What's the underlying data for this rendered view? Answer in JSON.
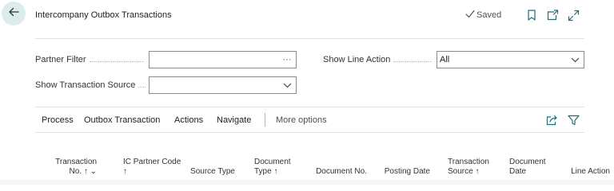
{
  "header": {
    "title": "Intercompany Outbox Transactions",
    "saved_label": "Saved"
  },
  "filters": {
    "partner_filter": {
      "label": "Partner Filter",
      "value": "",
      "lookup_glyph": "···"
    },
    "show_transaction_source": {
      "label": "Show Transaction Source",
      "value": ""
    },
    "show_line_action": {
      "label": "Show Line Action",
      "value": "All"
    }
  },
  "action_bar": {
    "items": [
      "Process",
      "Outbox Transaction",
      "Actions",
      "Navigate"
    ],
    "more": "More options"
  },
  "table": {
    "columns": [
      {
        "line1": "Transaction",
        "line2": "No.",
        "sort": "↑",
        "extra": "⌄"
      },
      {
        "line1": "IC Partner Code",
        "line2": "",
        "sort": "↑",
        "extra": ""
      },
      {
        "line1": "",
        "line2": "Source Type",
        "sort": "",
        "extra": ""
      },
      {
        "line1": "Document",
        "line2": "Type",
        "sort": "↑",
        "extra": ""
      },
      {
        "line1": "",
        "line2": "Document No.",
        "sort": "",
        "extra": ""
      },
      {
        "line1": "",
        "line2": "Posting Date",
        "sort": "",
        "extra": ""
      },
      {
        "line1": "Transaction",
        "line2": "Source",
        "sort": "↑",
        "extra": ""
      },
      {
        "line1": "Document",
        "line2": "Date",
        "sort": "",
        "extra": ""
      },
      {
        "line1": "",
        "line2": "Line Action",
        "sort": "",
        "extra": ""
      }
    ]
  },
  "icons": {
    "back": "arrow-left-icon",
    "saved": "checkmark-icon",
    "bookmark": "bookmark-icon",
    "open_new": "open-in-new-window-icon",
    "expand": "expand-icon",
    "share": "share-icon",
    "filter": "filter-icon"
  },
  "colors": {
    "accent": "#1f6e7a",
    "back_button_bg": "#dcecec",
    "divider": "#e1e1e1",
    "field_border": "#8a8a8a"
  }
}
